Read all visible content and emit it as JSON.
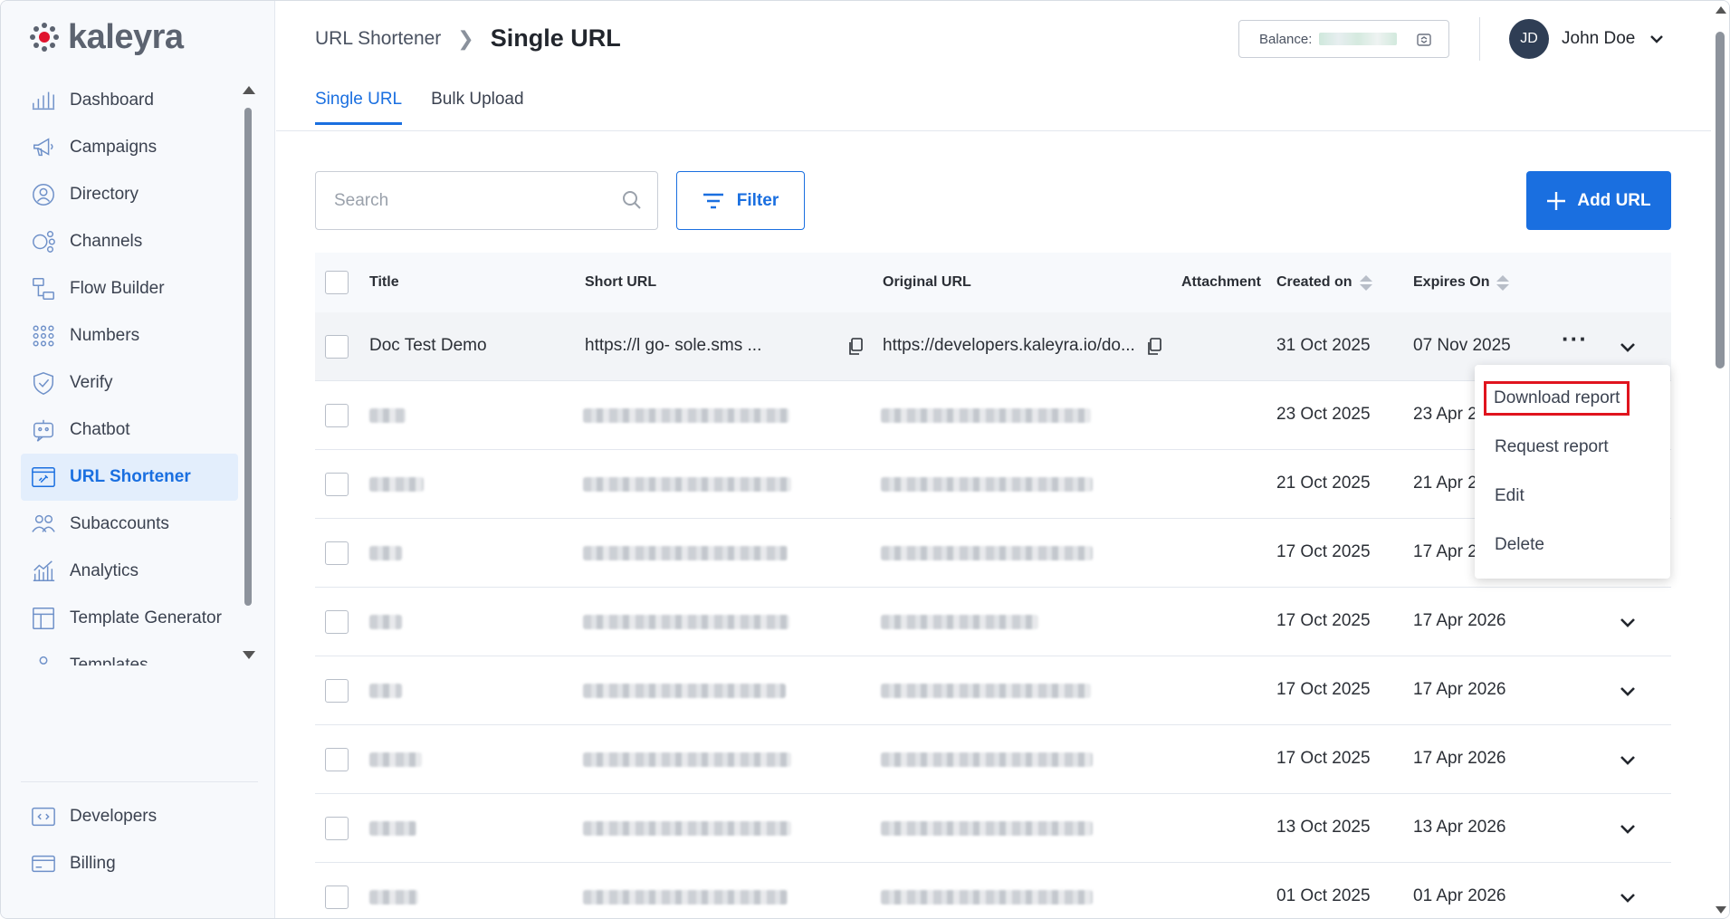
{
  "brand": {
    "name": "kaleyra",
    "color": "#1a6fe0"
  },
  "sidebar": {
    "items": [
      {
        "label": "Dashboard",
        "icon": "bar-chart-icon"
      },
      {
        "label": "Campaigns",
        "icon": "megaphone-icon"
      },
      {
        "label": "Directory",
        "icon": "contact-icon"
      },
      {
        "label": "Channels",
        "icon": "channels-icon"
      },
      {
        "label": "Flow Builder",
        "icon": "flow-icon"
      },
      {
        "label": "Numbers",
        "icon": "dialpad-icon"
      },
      {
        "label": "Verify",
        "icon": "shield-check-icon"
      },
      {
        "label": "Chatbot",
        "icon": "chatbot-icon"
      },
      {
        "label": "URL Shortener",
        "icon": "link-icon",
        "active": true
      },
      {
        "label": "Subaccounts",
        "icon": "users-icon"
      },
      {
        "label": "Analytics",
        "icon": "analytics-icon"
      },
      {
        "label": "Template Generator",
        "icon": "template-generator-icon"
      },
      {
        "label": "Templates",
        "icon": "templates-icon"
      }
    ],
    "bottom_items": [
      {
        "label": "Developers",
        "icon": "code-icon"
      },
      {
        "label": "Billing",
        "icon": "card-icon"
      }
    ]
  },
  "header": {
    "breadcrumb_parent": "URL Shortener",
    "breadcrumb_current": "Single URL",
    "balance_label": "Balance:",
    "user_initials": "JD",
    "user_name": "John Doe"
  },
  "tabs": [
    {
      "label": "Single URL",
      "active": true
    },
    {
      "label": "Bulk Upload",
      "active": false
    }
  ],
  "toolbar": {
    "search_placeholder": "Search",
    "filter_label": "Filter",
    "add_label": "Add URL"
  },
  "table": {
    "columns": {
      "title": "Title",
      "short_url": "Short URL",
      "original_url": "Original URL",
      "attachment": "Attachment",
      "created_on": "Created on",
      "expires_on": "Expires On"
    },
    "rows": [
      {
        "title": "Doc Test Demo",
        "short_url": "https://l     go-     sole.sms     ...",
        "original_url": "https://developers.kaleyra.io/do...",
        "created": "31 Oct 2025",
        "expires": "07 Nov 2025",
        "redacted": false
      },
      {
        "created": "23 Oct 2025",
        "expires": "23 Apr 2",
        "redacted": true
      },
      {
        "created": "21 Oct 2025",
        "expires": "21 Apr 2",
        "redacted": true
      },
      {
        "created": "17 Oct 2025",
        "expires": "17 Apr 2",
        "redacted": true
      },
      {
        "created": "17 Oct 2025",
        "expires": "17 Apr 2026",
        "redacted": true
      },
      {
        "created": "17 Oct 2025",
        "expires": "17 Apr 2026",
        "redacted": true
      },
      {
        "created": "17 Oct 2025",
        "expires": "17 Apr 2026",
        "redacted": true
      },
      {
        "created": "13 Oct 2025",
        "expires": "13 Apr 2026",
        "redacted": true
      },
      {
        "created": "01 Oct 2025",
        "expires": "01 Apr 2026",
        "redacted": true
      }
    ]
  },
  "row_menu": {
    "items": [
      {
        "label": "Download report",
        "highlighted": true
      },
      {
        "label": "Request report"
      },
      {
        "label": "Edit"
      },
      {
        "label": "Delete"
      }
    ],
    "highlight_color": "#e0141e"
  }
}
